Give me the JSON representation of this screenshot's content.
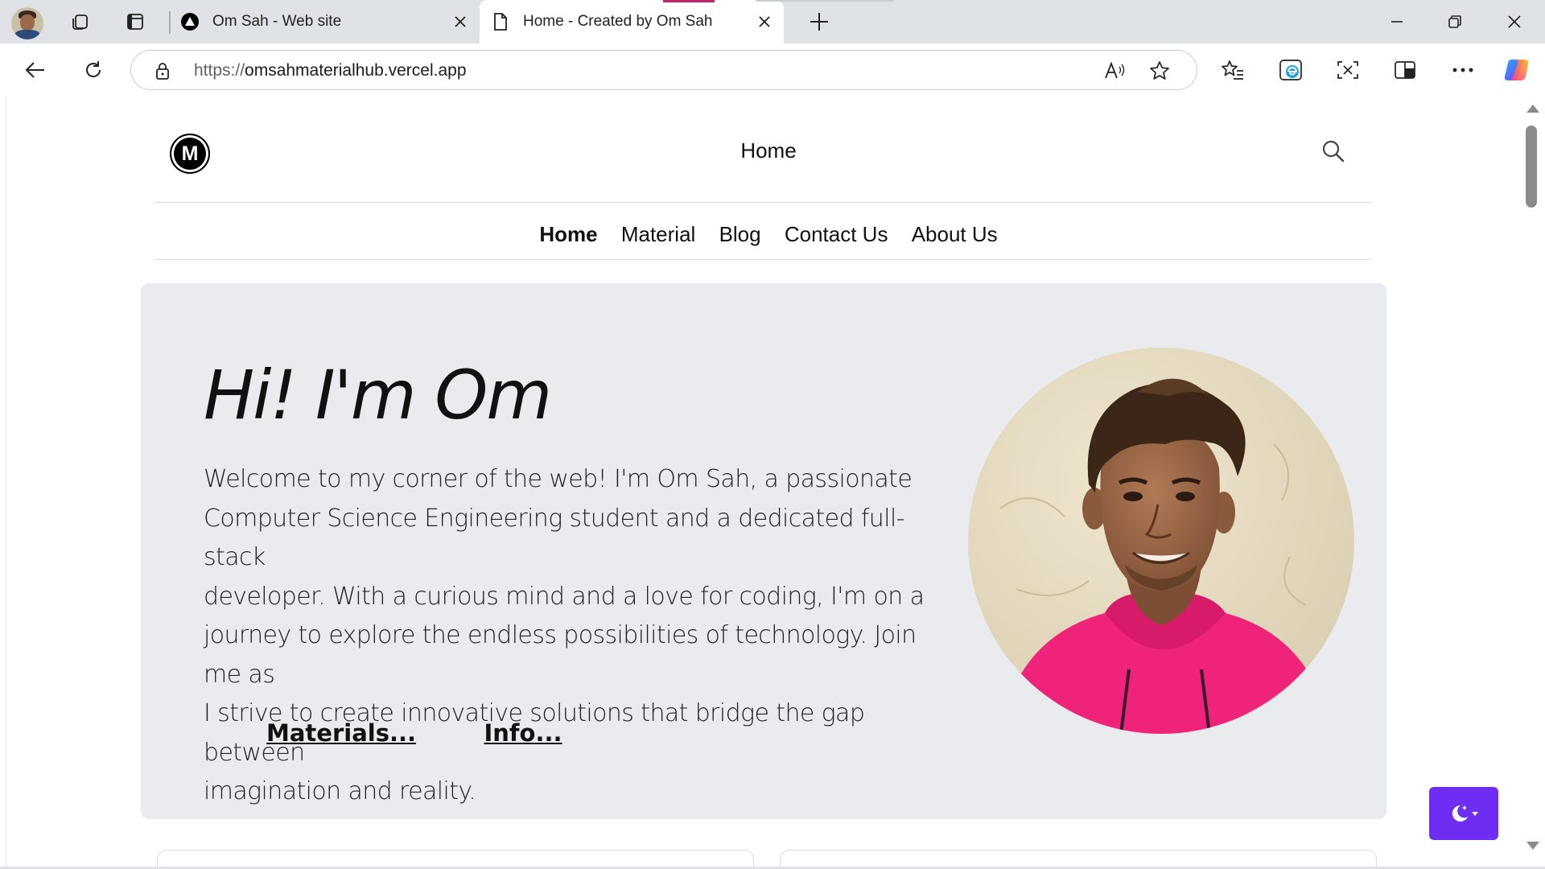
{
  "browser": {
    "tabs": [
      {
        "title": "Om Sah - Web site",
        "favicon": "vercel-triangle-icon",
        "active": false
      },
      {
        "title": "Home - Created by Om Sah",
        "favicon": "document-icon",
        "active": true
      }
    ],
    "address_bar": {
      "scheme": "https://",
      "host": "omsahmaterialhub.vercel.app"
    },
    "toolbar_icons": [
      "back-icon",
      "refresh-icon",
      "read-aloud-icon",
      "favorite-star-icon",
      "favorites-icon",
      "edge-icon",
      "screenshot-icon",
      "split-screen-icon",
      "more-icon",
      "copilot-icon"
    ],
    "colors": {
      "tabstrip": "#dfe3e8",
      "accent": "#c0246b"
    }
  },
  "site": {
    "logo_letter": "M",
    "header_title": "Home",
    "nav": [
      {
        "label": "Home",
        "active": true
      },
      {
        "label": "Material",
        "active": false
      },
      {
        "label": "Blog",
        "active": false
      },
      {
        "label": "Contact Us",
        "active": false
      },
      {
        "label": "About Us",
        "active": false
      }
    ],
    "hero": {
      "heading": "Hi! I'm Om",
      "lines": [
        "Welcome to my corner of the web! I'm Om Sah, a passionate",
        "Computer Science Engineering student and a dedicated full-stack",
        "developer. With a curious mind and a love for coding, I'm on a",
        "journey to explore the endless possibilities of technology. Join me as",
        "I strive to create innovative solutions that bridge the gap between",
        "imagination and reality."
      ],
      "links": [
        "Materials...",
        "Info..."
      ]
    },
    "theme_toggle_icon": "moon-icon",
    "colors": {
      "hero_bg": "#e9ebee",
      "theme_button": "#6f2cf3"
    }
  }
}
